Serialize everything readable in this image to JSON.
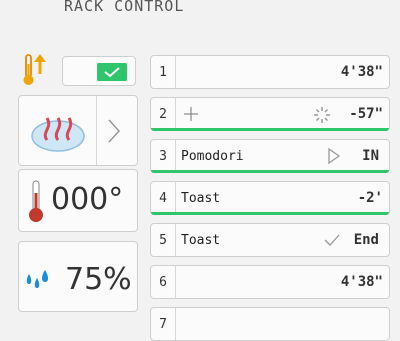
{
  "header": {
    "title": "RACK CONTROL"
  },
  "sidebar": {
    "arrows_icon": "thermo-up-arrow-icon",
    "checkbox_checked": true,
    "steam_icon": "steam-icon",
    "temperature": "000°",
    "humidity": "75%"
  },
  "racks": [
    {
      "num": "1",
      "name": "",
      "status": "",
      "time": "4'38\"",
      "bar": false
    },
    {
      "num": "2",
      "name": "",
      "status": "",
      "time": "-57\"",
      "bar": true,
      "icon": "plus-icon",
      "status_icon": "loading-icon"
    },
    {
      "num": "3",
      "name": "Pomodori",
      "status": "IN",
      "time": "",
      "bar": true,
      "status_icon": "play-icon"
    },
    {
      "num": "4",
      "name": "Toast",
      "status": "",
      "time": "-2'",
      "bar": true
    },
    {
      "num": "5",
      "name": "Toast",
      "status": "End",
      "time": "",
      "bar": false,
      "status_icon": "check-icon"
    },
    {
      "num": "6",
      "name": "",
      "status": "",
      "time": "4'38\"",
      "bar": false
    },
    {
      "num": "7",
      "name": "",
      "status": "",
      "time": "",
      "bar": false
    }
  ],
  "colors": {
    "accent": "#2fc56a",
    "thermo_red": "#c0392b",
    "water_blue": "#1a8fd6",
    "arrow_yellow": "#f0a500"
  }
}
